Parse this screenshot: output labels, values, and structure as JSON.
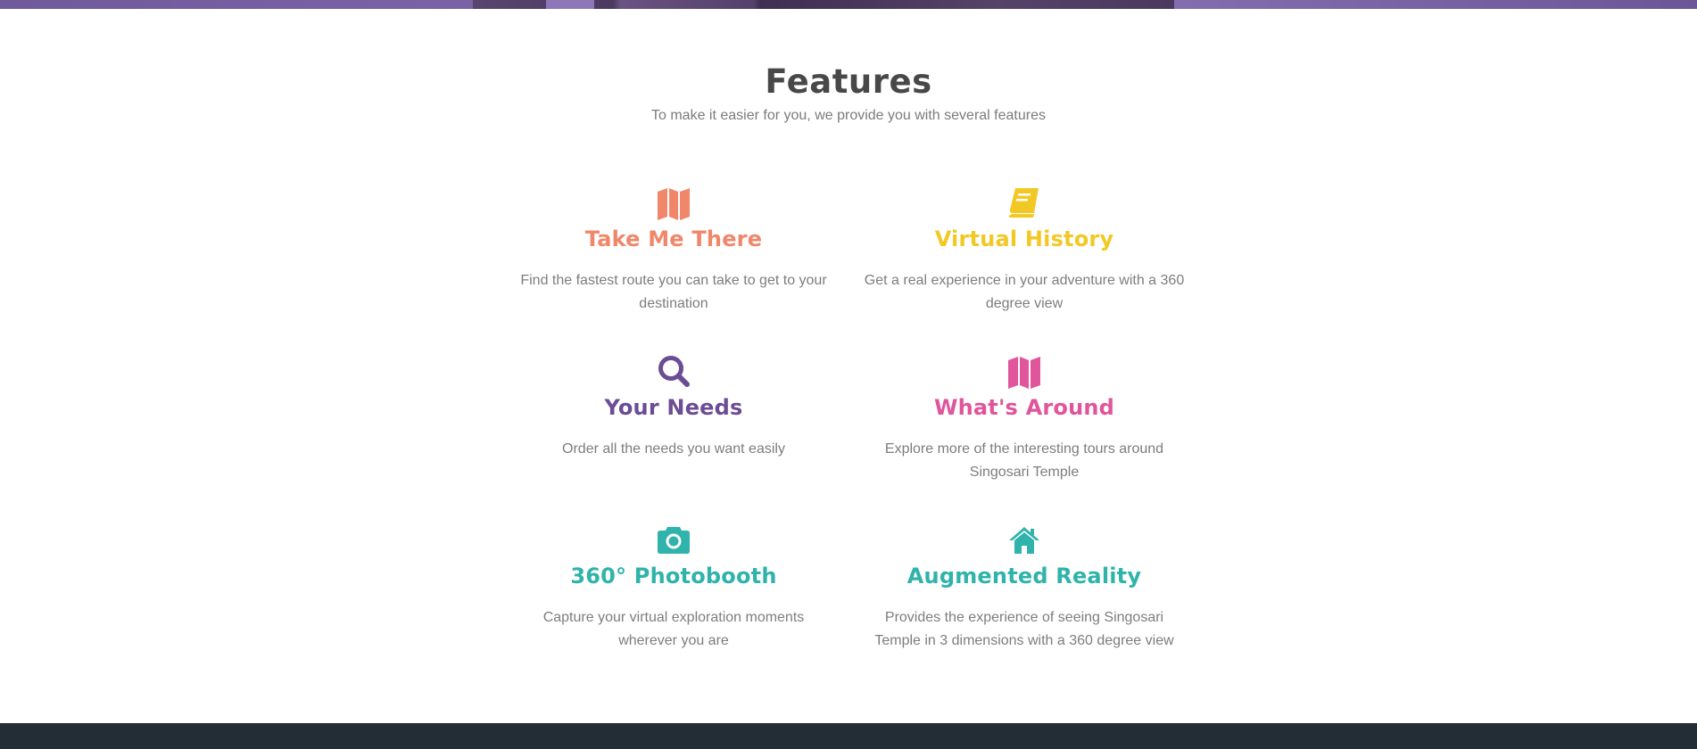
{
  "section": {
    "title": "Features",
    "subtitle": "To make it easier for you, we provide you with several features"
  },
  "features": [
    {
      "title": "Take Me There",
      "description": "Find the fastest route you can take to get to your destination",
      "icon": "map-icon",
      "color": "#f0876a"
    },
    {
      "title": "Virtual History",
      "description": "Get a real experience in your adventure with a 360 degree view",
      "icon": "book-icon",
      "color": "#f2c924"
    },
    {
      "title": "Your Needs",
      "description": "Order all the needs you want easily",
      "icon": "search-icon",
      "color": "#6b4c95"
    },
    {
      "title": "What's Around",
      "description": "Explore more of the interesting tours around Singosari Temple",
      "icon": "map-icon",
      "color": "#e0559b"
    },
    {
      "title": "360° Photobooth",
      "description": "Capture your virtual exploration moments wherever you are",
      "icon": "camera-icon",
      "color": "#2fb3aa"
    },
    {
      "title": "Augmented Reality",
      "description": "Provides the experience of seeing Singosari Temple in 3 dimensions with a 360 degree view",
      "icon": "home-icon",
      "color": "#2fb3aa"
    }
  ],
  "colors": {
    "heading": "#484848",
    "body_text": "#7d7d7d",
    "footer": "#222d35",
    "banner": "#7c63a8"
  }
}
